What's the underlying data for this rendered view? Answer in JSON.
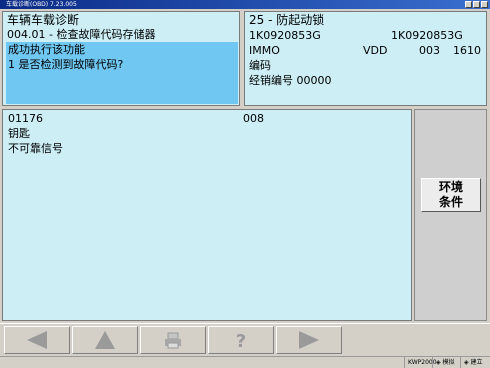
{
  "window": {
    "title": "车载诊断(OBD) 7.23.005"
  },
  "left_panel": {
    "title": "车辆车载诊断",
    "function": "004.01 - 检查故障代码存储器",
    "message_line1": "成功执行该功能",
    "message_line2": "1 是否检测到故障代码?"
  },
  "right_panel": {
    "title": "25 - 防起动锁",
    "part_no_1": "1K0920853G",
    "part_no_2": "1K0920853G",
    "system": "IMMO",
    "vdd": "VDD",
    "num1": "003",
    "num2": "1610",
    "coding": "编码",
    "dealer": "经销编号 00000"
  },
  "main": {
    "code": "01176",
    "code_num": "008",
    "line2": "钥匙",
    "line3": "不可靠信号"
  },
  "side": {
    "button_line1": "环境",
    "button_line2": "条件"
  },
  "toolbar": {
    "icons": [
      "back-arrow-icon",
      "up-arrow-icon",
      "print-icon",
      "help-icon",
      "forward-arrow-icon"
    ]
  },
  "status": {
    "model": "KWP2000",
    "mode": "模拟",
    "connection": "建立"
  },
  "colors": {
    "panel_bg": "#cdeef5",
    "highlight": "#6fc7f2",
    "titlebar": "#0a2a86"
  }
}
